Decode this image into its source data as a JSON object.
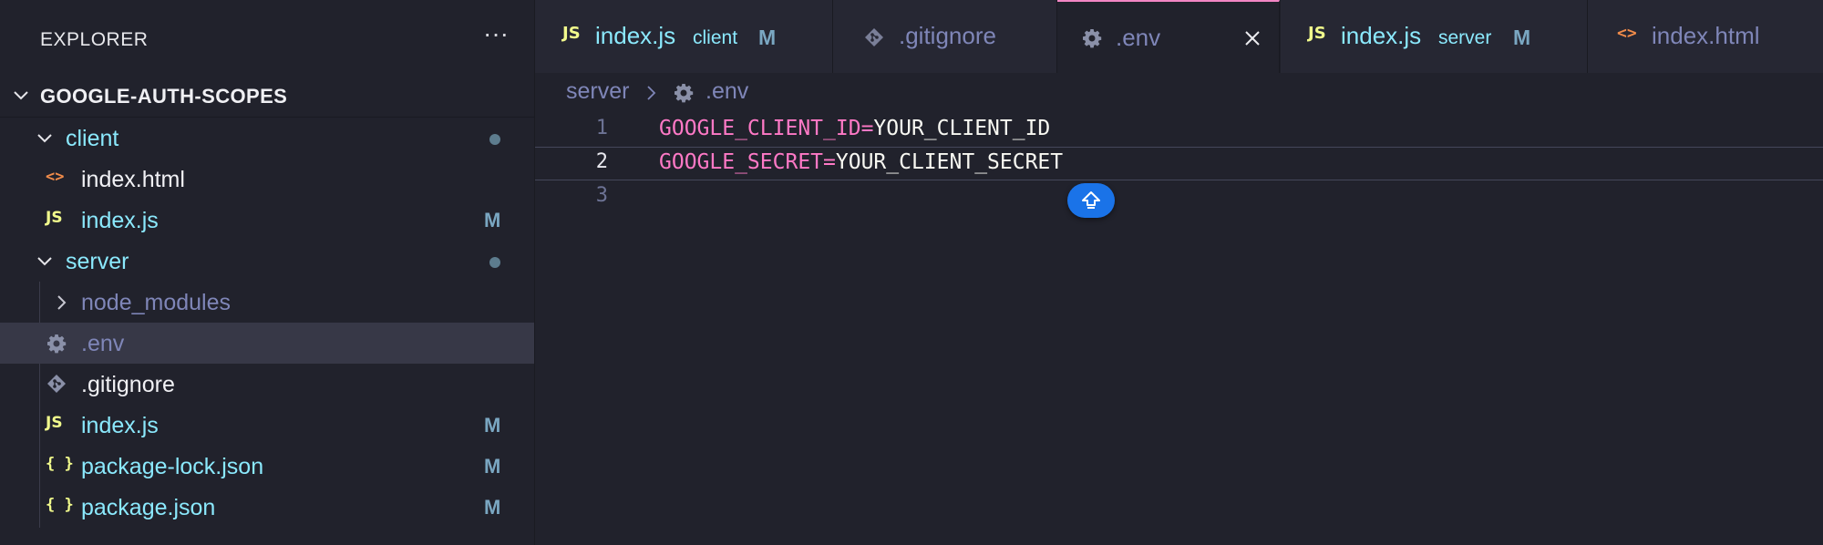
{
  "explorer": {
    "title": "EXPLORER",
    "more_label": "···",
    "root_label": "GOOGLE-AUTH-SCOPES",
    "items": [
      {
        "label": "client",
        "status": "",
        "kind": "folder"
      },
      {
        "label": "index.html",
        "status": "",
        "kind": "html"
      },
      {
        "label": "index.js",
        "status": "M",
        "kind": "js"
      },
      {
        "label": "server",
        "status": "",
        "kind": "folder"
      },
      {
        "label": "node_modules",
        "status": "",
        "kind": "folder"
      },
      {
        "label": ".env",
        "status": "",
        "kind": "gear"
      },
      {
        "label": ".gitignore",
        "status": "",
        "kind": "git"
      },
      {
        "label": "index.js",
        "status": "M",
        "kind": "js"
      },
      {
        "label": "package-lock.json",
        "status": "M",
        "kind": "json"
      },
      {
        "label": "package.json",
        "status": "M",
        "kind": "json"
      }
    ]
  },
  "icons": {
    "js": "JS",
    "json": "{ }",
    "html": "<>"
  },
  "tabs": [
    {
      "label": "index.js",
      "description": "client",
      "status": "M"
    },
    {
      "label": ".gitignore",
      "description": "",
      "status": ""
    },
    {
      "label": ".env",
      "description": "",
      "status": ""
    },
    {
      "label": "index.js",
      "description": "server",
      "status": "M"
    },
    {
      "label": "index.html",
      "description": "",
      "status": ""
    }
  ],
  "breadcrumb": {
    "folder": "server",
    "file": ".env"
  },
  "editor": {
    "lines": [
      {
        "number": "1",
        "key": "GOOGLE_CLIENT_ID",
        "eq": "=",
        "value": "YOUR_CLIENT_ID"
      },
      {
        "number": "2",
        "key": "GOOGLE_SECRET",
        "eq": "=",
        "value": "YOUR_CLIENT_SECRET"
      },
      {
        "number": "3",
        "key": "",
        "eq": "",
        "value": ""
      }
    ]
  },
  "colors": {
    "accent_tab_border": "#f286c4",
    "key_color": "#ff79c6",
    "fab_color": "#1a73e8"
  }
}
